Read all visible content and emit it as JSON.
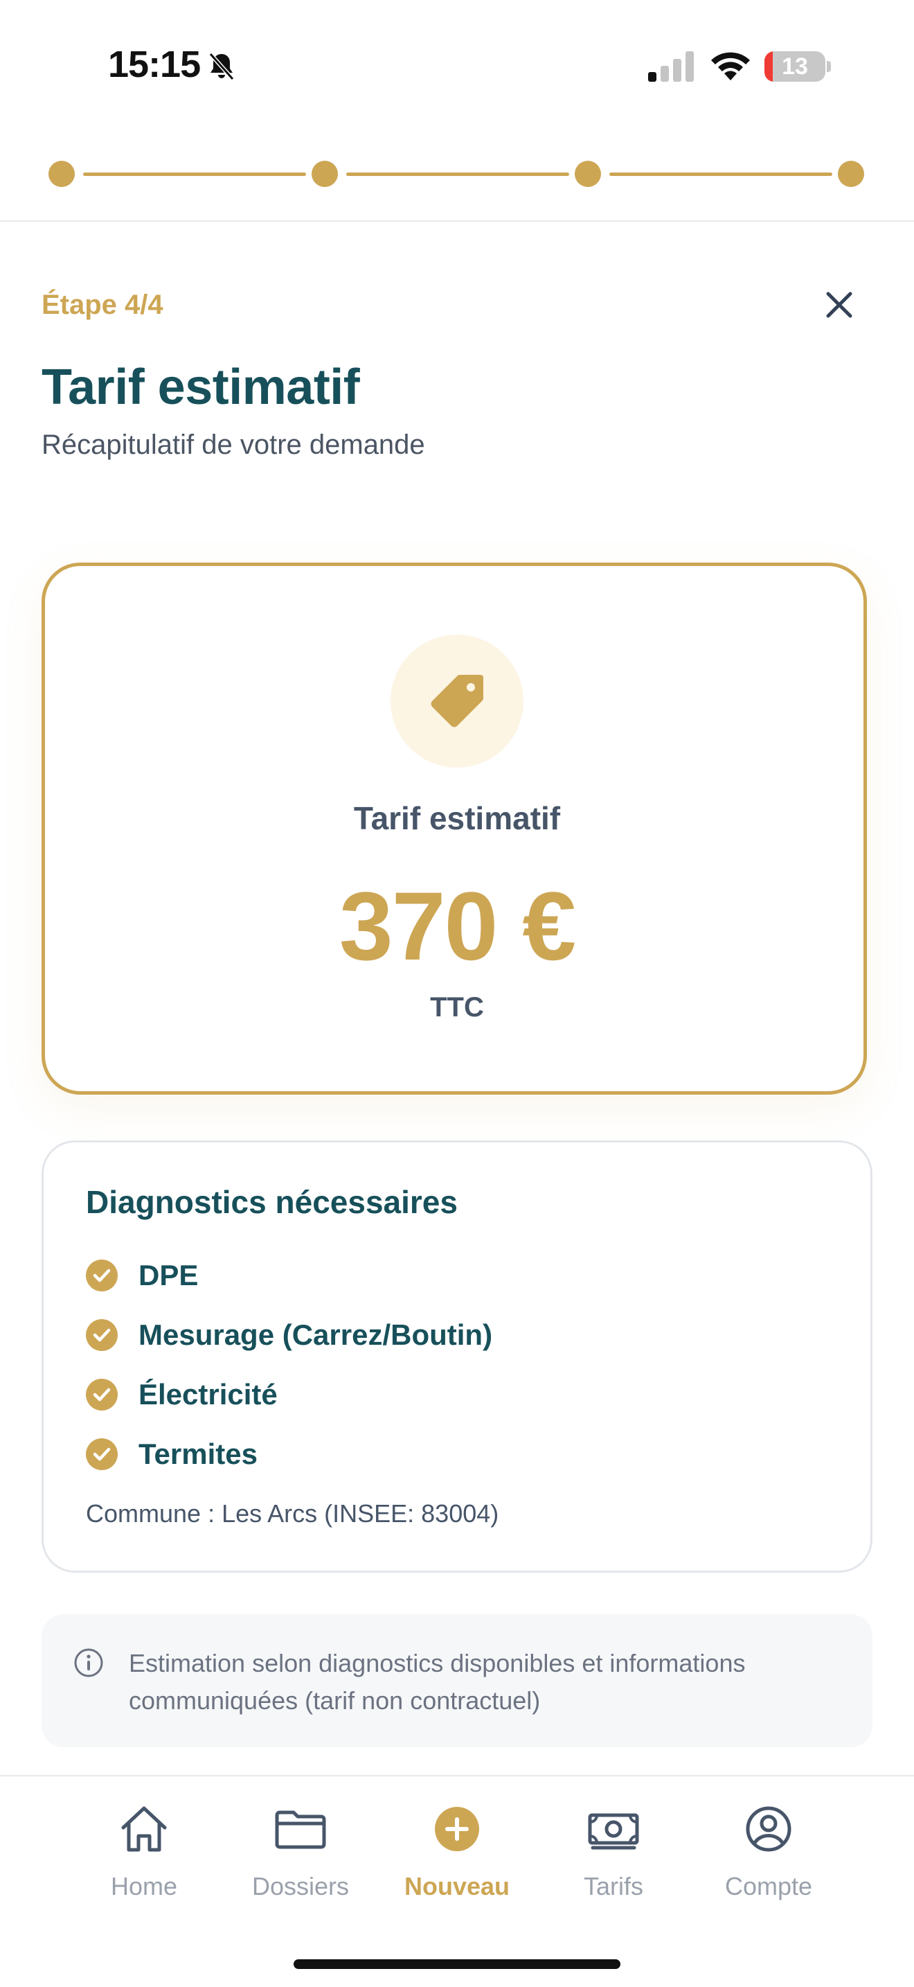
{
  "status_bar": {
    "time": "15:15",
    "battery_level": "13",
    "icons": [
      "bell-slash-icon",
      "cellular-signal-icon",
      "wifi-icon",
      "battery-icon"
    ]
  },
  "stepper": {
    "current_step": 4,
    "total_steps": 4
  },
  "header": {
    "step_label": "Étape 4/4",
    "title": "Tarif estimatif",
    "subtitle": "Récapitulatif de votre demande",
    "close_icon": "close-icon"
  },
  "price_card": {
    "icon": "price-tag-icon",
    "label": "Tarif estimatif",
    "amount": "370 €",
    "tax_note": "TTC"
  },
  "diagnostics": {
    "title": "Diagnostics nécessaires",
    "items": [
      {
        "label": "DPE"
      },
      {
        "label": "Mesurage (Carrez/Boutin)"
      },
      {
        "label": "Électricité"
      },
      {
        "label": "Termites"
      }
    ],
    "commune": "Commune : Les Arcs (INSEE: 83004)"
  },
  "info": {
    "icon": "info-icon",
    "text": "Estimation selon diagnostics disponibles et informations communiquées (tarif non contractuel)"
  },
  "tab_bar": {
    "tabs": [
      {
        "label": "Home",
        "icon": "home-icon",
        "active": false
      },
      {
        "label": "Dossiers",
        "icon": "folder-icon",
        "active": false
      },
      {
        "label": "Nouveau",
        "icon": "plus-circle-icon",
        "active": true
      },
      {
        "label": "Tarifs",
        "icon": "banknote-icon",
        "active": false
      },
      {
        "label": "Compte",
        "icon": "user-circle-icon",
        "active": false
      }
    ]
  },
  "colors": {
    "accent": "#cda654",
    "title": "#17505a",
    "muted": "#475569",
    "tab_inactive": "#9aa1ab"
  }
}
